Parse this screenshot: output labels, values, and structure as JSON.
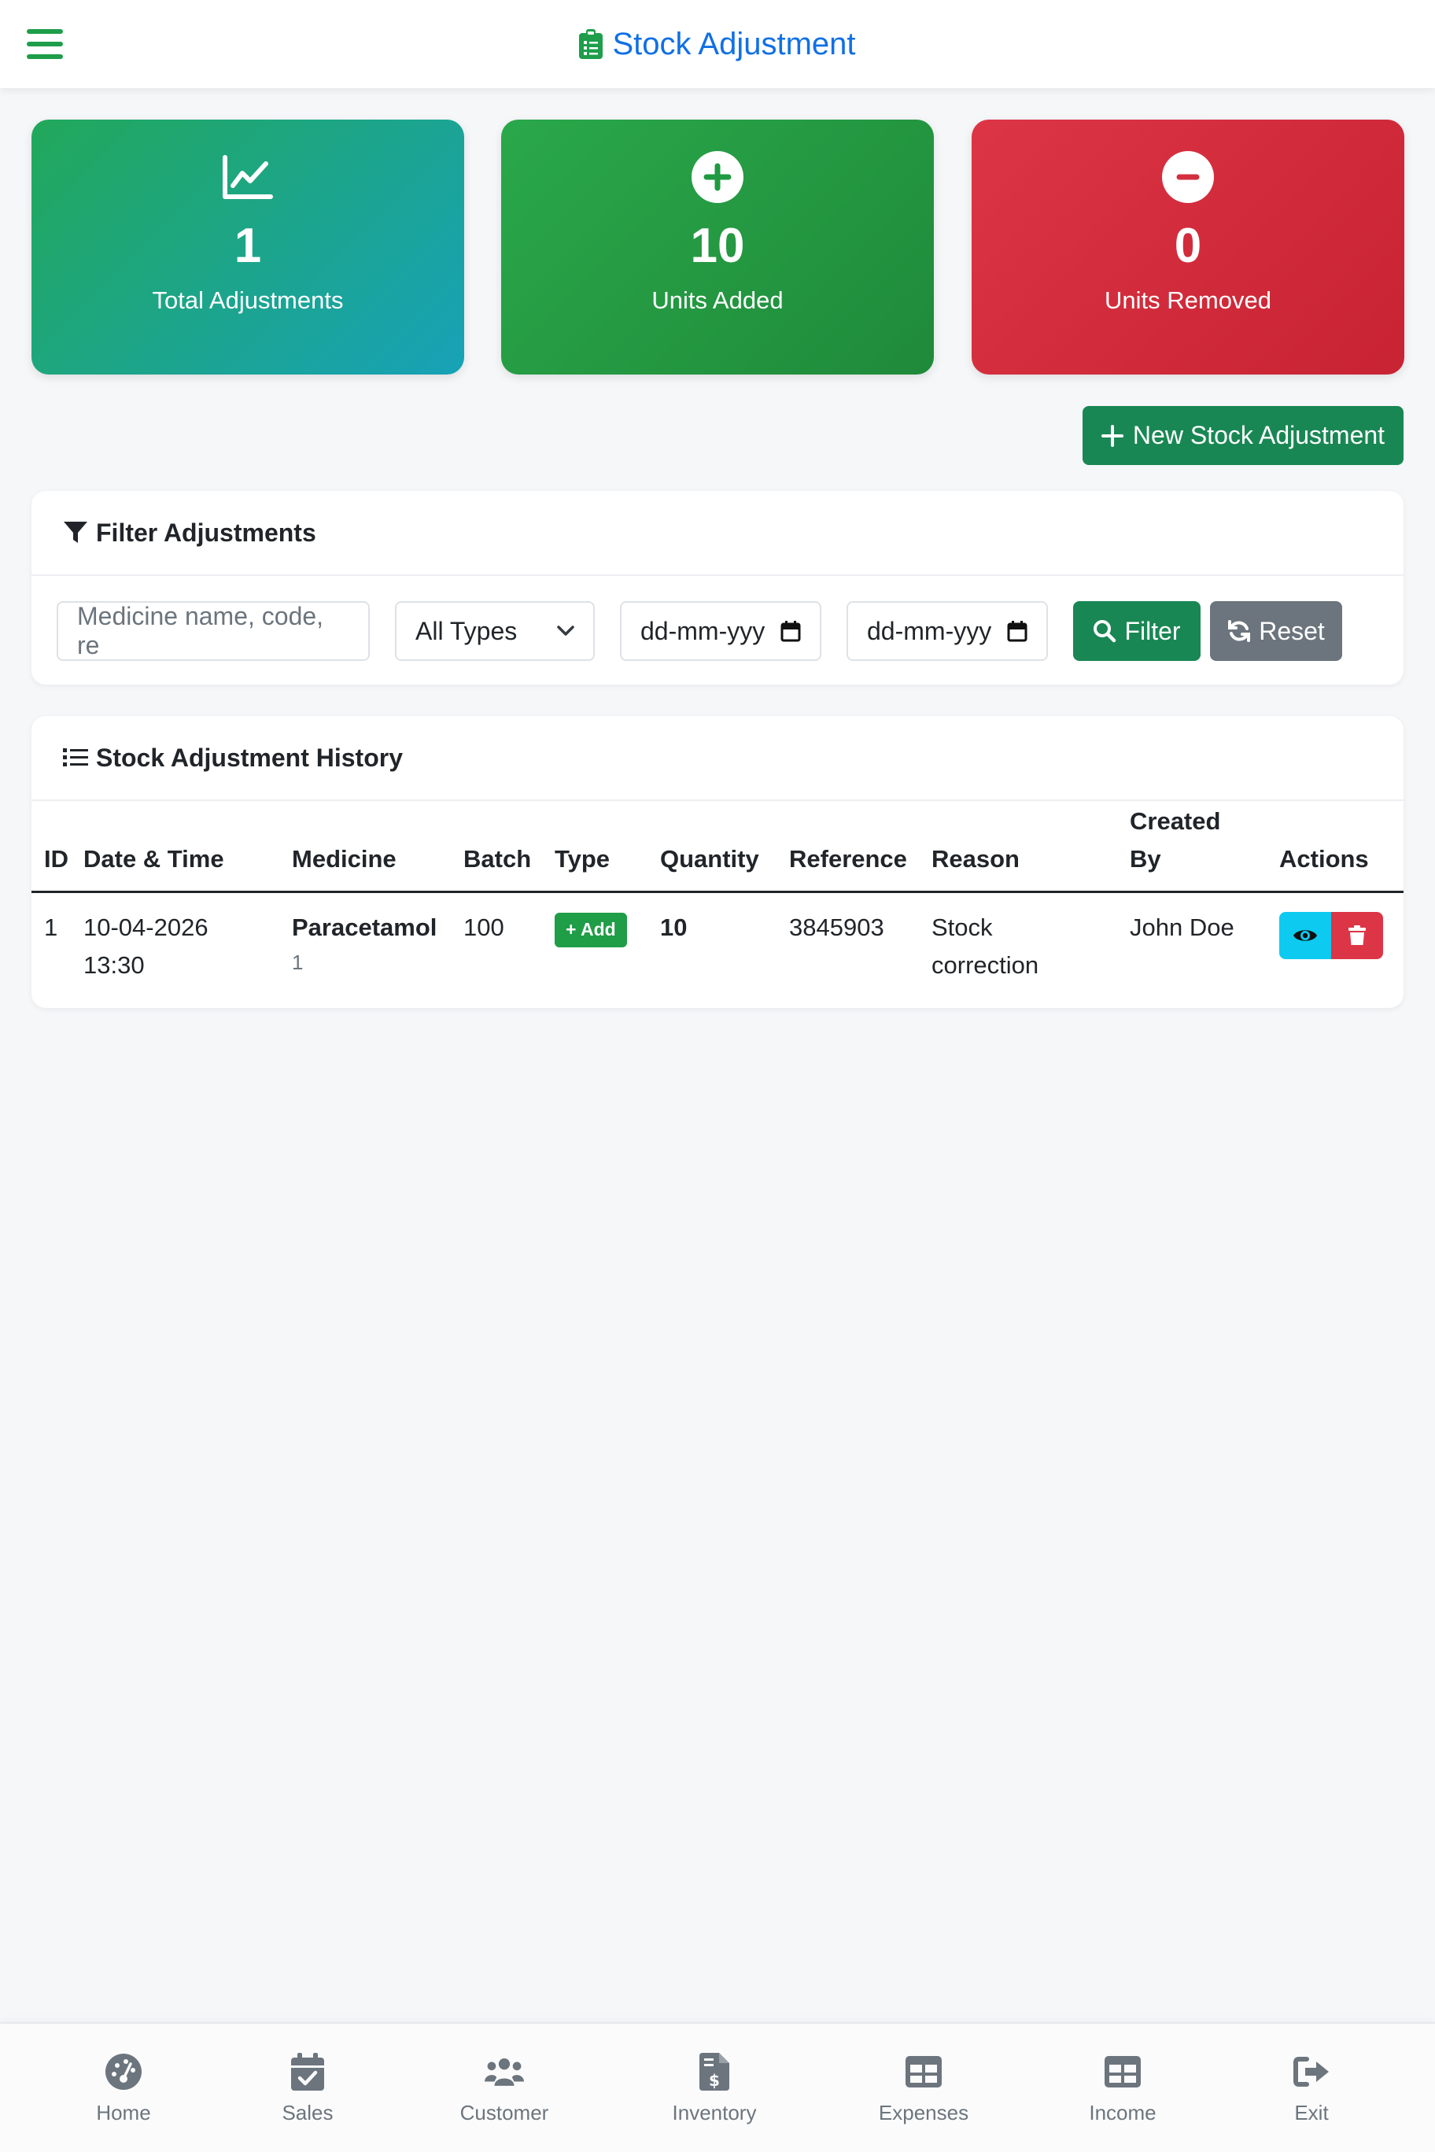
{
  "header": {
    "title": "Stock Adjustment",
    "menu_icon": "hamburger-menu-icon",
    "title_icon": "clipboard-list-icon"
  },
  "stats": [
    {
      "value": "1",
      "label": "Total Adjustments",
      "icon": "chart-line-icon"
    },
    {
      "value": "10",
      "label": "Units Added",
      "icon": "plus-circle-icon"
    },
    {
      "value": "0",
      "label": "Units Removed",
      "icon": "minus-circle-icon"
    }
  ],
  "actions": {
    "new_adjustment": "New Stock Adjustment"
  },
  "filter": {
    "title": "Filter Adjustments",
    "search_placeholder": "Medicine name, code, re",
    "type_selected": "All Types",
    "date_from_placeholder": "dd-mm-yyy",
    "date_to_placeholder": "dd-mm-yyy",
    "filter_label": "Filter",
    "reset_label": "Reset"
  },
  "history": {
    "title": "Stock Adjustment History",
    "columns": [
      "ID",
      "Date & Time",
      "Medicine",
      "Batch",
      "Type",
      "Quantity",
      "Reference",
      "Reason",
      "Created By",
      "Actions"
    ],
    "rows": [
      {
        "id": "1",
        "date": "10-04-2026",
        "time": "13:30",
        "medicine": "Paracetamol",
        "medicine_sub": "1",
        "batch": "100",
        "type": "+ Add",
        "quantity": "10",
        "reference": "3845903",
        "reason": "Stock correction",
        "created_by": "John Doe"
      }
    ]
  },
  "colors": {
    "primary_green": "#198754",
    "title_blue": "#1170e4",
    "danger": "#dc3545",
    "info": "#0dcaf0",
    "secondary": "#6c757d"
  },
  "bottom_nav": [
    {
      "label": "Home",
      "icon": "dashboard-gauge-icon"
    },
    {
      "label": "Sales",
      "icon": "calendar-check-icon"
    },
    {
      "label": "Customer",
      "icon": "users-icon"
    },
    {
      "label": "Inventory",
      "icon": "file-invoice-dollar-icon"
    },
    {
      "label": "Expenses",
      "icon": "table-grid-icon"
    },
    {
      "label": "Income",
      "icon": "table-grid-icon"
    },
    {
      "label": "Exit",
      "icon": "sign-out-icon"
    }
  ]
}
